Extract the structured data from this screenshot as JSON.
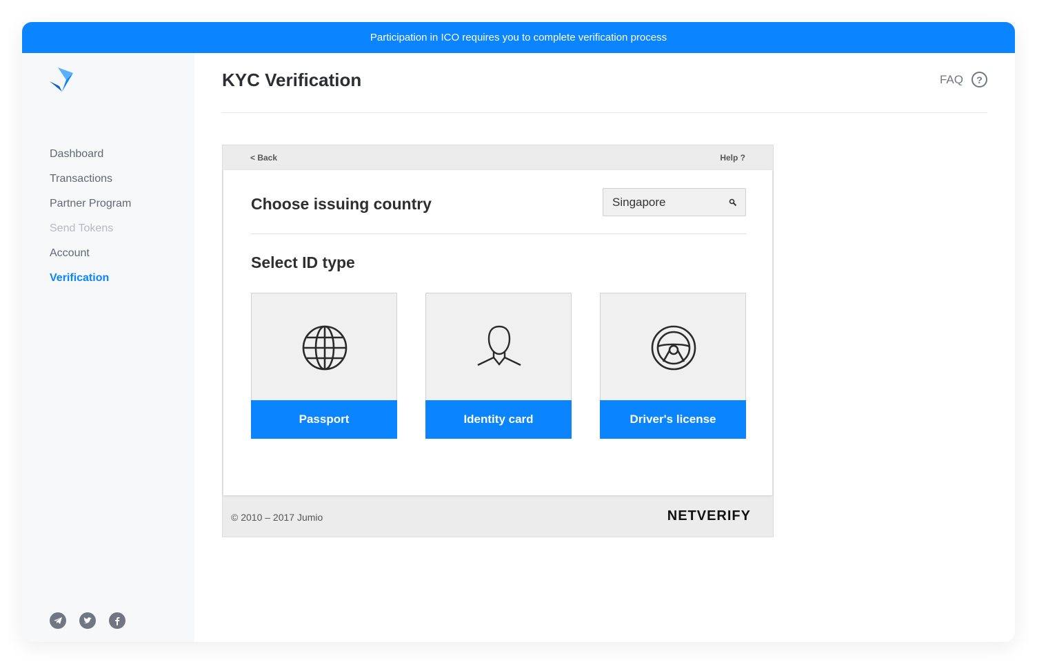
{
  "banner": {
    "text": "Participation in ICO requires you to complete verification process"
  },
  "sidebar": {
    "nav": [
      {
        "label": "Dashboard",
        "state": "normal"
      },
      {
        "label": "Transactions",
        "state": "normal"
      },
      {
        "label": "Partner Program",
        "state": "normal"
      },
      {
        "label": "Send Tokens",
        "state": "disabled"
      },
      {
        "label": "Account",
        "state": "normal"
      },
      {
        "label": "Verification",
        "state": "active"
      }
    ],
    "social_icons": [
      "telegram-icon",
      "twitter-icon",
      "facebook-icon"
    ]
  },
  "header": {
    "title": "KYC Verification",
    "faq_label": "FAQ",
    "faq_icon": "?"
  },
  "widget": {
    "back_label": "< Back",
    "help_label": "Help ?",
    "choose_title": "Choose issuing country",
    "country_value": "Singapore",
    "select_title": "Select ID type",
    "id_types": [
      {
        "label": "Passport",
        "icon": "globe-icon"
      },
      {
        "label": "Identity card",
        "icon": "person-icon"
      },
      {
        "label": "Driver's license",
        "icon": "steering-wheel-icon"
      }
    ],
    "copyright": "© 2010 – 2017 Jumio",
    "brand": "NETVERIFY"
  },
  "colors": {
    "accent": "#0a84ff",
    "sidebar_bg": "#f7f8fa",
    "card_bg": "#f0f0f0"
  }
}
